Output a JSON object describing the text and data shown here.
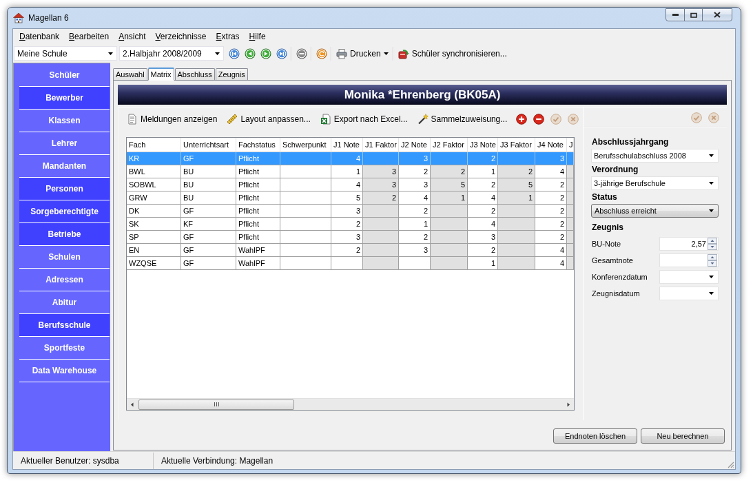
{
  "window": {
    "title": "Magellan 6"
  },
  "menu": [
    "Datenbank",
    "Bearbeiten",
    "Ansicht",
    "Verzeichnisse",
    "Extras",
    "Hilfe"
  ],
  "toolbar": {
    "school": "Meine Schule",
    "term": "2.Halbjahr 2008/2009",
    "print": "Drucken",
    "sync": "Schüler synchronisieren..."
  },
  "sidebar": {
    "items": [
      {
        "label": "Schüler",
        "color": "#6666ff"
      },
      {
        "label": "Bewerber",
        "color": "#4040ff"
      },
      {
        "label": "Klassen",
        "color": "#6666ff"
      },
      {
        "label": "Lehrer",
        "color": "#6666ff"
      },
      {
        "label": "Mandanten",
        "color": "#6666ff"
      },
      {
        "label": "Personen",
        "color": "#4040ff"
      },
      {
        "label": "Sorgeberechtigte",
        "color": "#4040ff"
      },
      {
        "label": "Betriebe",
        "color": "#4040ff"
      },
      {
        "label": "Schulen",
        "color": "#6666ff"
      },
      {
        "label": "Adressen",
        "color": "#6666ff"
      },
      {
        "label": "Abitur",
        "color": "#6666ff"
      },
      {
        "label": "Berufsschule",
        "color": "#4040ff"
      },
      {
        "label": "Sportfeste",
        "color": "#6666ff"
      },
      {
        "label": "Data Warehouse",
        "color": "#6666ff"
      }
    ]
  },
  "tabs": [
    {
      "label": "Auswahl",
      "selected": false
    },
    {
      "label": "Matrix",
      "selected": true
    },
    {
      "label": "Abschluss",
      "selected": false
    },
    {
      "label": "Zeugnis",
      "selected": false
    }
  ],
  "student": {
    "name": "Monika *Ehrenberg (BK05A)"
  },
  "matrix": {
    "toolbar": [
      {
        "label": "Meldungen anzeigen",
        "kind": "messages"
      },
      {
        "label": "Layout anpassen...",
        "kind": "layout"
      },
      {
        "label": "Export nach Excel...",
        "kind": "export"
      },
      {
        "label": "Sammelzuweisung...",
        "kind": "assign"
      }
    ],
    "row_actions": [
      {
        "kind": "add",
        "disabled": false
      },
      {
        "kind": "remove",
        "disabled": false
      },
      {
        "kind": "confirm",
        "disabled": true
      },
      {
        "kind": "cancel",
        "disabled": true
      }
    ],
    "table": {
      "columns": [
        {
          "label": "Fach",
          "kind": "text"
        },
        {
          "label": "Unterrichtsart",
          "kind": "text"
        },
        {
          "label": "Fachstatus",
          "kind": "text"
        },
        {
          "label": "Schwerpunkt",
          "kind": "text"
        },
        {
          "label": "J1 Note",
          "kind": "grade"
        },
        {
          "label": "J1 Faktor",
          "kind": "factor"
        },
        {
          "label": "J2 Note",
          "kind": "grade"
        },
        {
          "label": "J2 Faktor",
          "kind": "factor"
        },
        {
          "label": "J3 Note",
          "kind": "grade"
        },
        {
          "label": "J3 Faktor",
          "kind": "factor"
        },
        {
          "label": "J4 Note",
          "kind": "grade"
        },
        {
          "label": "J",
          "kind": "factor"
        }
      ],
      "rows": [
        {
          "selected": true,
          "fach": "KR",
          "unterrichtsart": "GF",
          "fachstatus": "Pflicht",
          "j1_note": "4",
          "j2_note": "3",
          "j3_note": "2",
          "j4_note": "3"
        },
        {
          "selected": false,
          "fach": "BWL",
          "unterrichtsart": "BU",
          "fachstatus": "Pflicht",
          "j1_note": "1",
          "j1_faktor": "3",
          "j2_note": "2",
          "j2_faktor": "2",
          "j3_note": "1",
          "j3_faktor": "2",
          "j4_note": "4"
        },
        {
          "selected": false,
          "fach": "SOBWL",
          "unterrichtsart": "BU",
          "fachstatus": "Pflicht",
          "j1_note": "4",
          "j1_faktor": "3",
          "j2_note": "3",
          "j2_faktor": "5",
          "j3_note": "2",
          "j3_faktor": "5",
          "j4_note": "2"
        },
        {
          "selected": false,
          "fach": "GRW",
          "unterrichtsart": "BU",
          "fachstatus": "Pflicht",
          "j1_note": "5",
          "j1_faktor": "2",
          "j2_note": "4",
          "j2_faktor": "1",
          "j3_note": "4",
          "j3_faktor": "1",
          "j4_note": "2"
        },
        {
          "selected": false,
          "fach": "DK",
          "unterrichtsart": "GF",
          "fachstatus": "Pflicht",
          "j1_note": "3",
          "j2_note": "2",
          "j3_note": "2",
          "j4_note": "2"
        },
        {
          "selected": false,
          "fach": "SK",
          "unterrichtsart": "KF",
          "fachstatus": "Pflicht",
          "j1_note": "2",
          "j2_note": "1",
          "j3_note": "4",
          "j4_note": "2"
        },
        {
          "selected": false,
          "fach": "SP",
          "unterrichtsart": "GF",
          "fachstatus": "Pflicht",
          "j1_note": "3",
          "j2_note": "2",
          "j3_note": "3",
          "j4_note": "2"
        },
        {
          "selected": false,
          "fach": "EN",
          "unterrichtsart": "GF",
          "fachstatus": "WahlPF",
          "j1_note": "2",
          "j2_note": "3",
          "j3_note": "2",
          "j4_note": "4"
        },
        {
          "selected": false,
          "fach": "WZQSE",
          "unterrichtsart": "GF",
          "fachstatus": "WahlPF",
          "j3_note": "1",
          "j4_note": "4"
        }
      ]
    }
  },
  "details": {
    "actions": [
      {
        "kind": "confirm",
        "disabled": true
      },
      {
        "kind": "cancel",
        "disabled": true
      }
    ],
    "fields": [
      {
        "kind": "heading",
        "label": "Abschlussjahrgang"
      },
      {
        "kind": "select",
        "value": "Berufsschulabschluss 2008"
      },
      {
        "kind": "heading",
        "label": "Verordnung"
      },
      {
        "kind": "select",
        "value": "3-jährige Berufschule"
      },
      {
        "kind": "heading",
        "label": "Status"
      },
      {
        "kind": "status_select",
        "value": "Abschluss erreicht"
      },
      {
        "kind": "heading",
        "label": "Zeugnis"
      },
      {
        "kind": "spinner",
        "label": "BU-Note",
        "value": "2,57"
      },
      {
        "kind": "spinner",
        "label": "Gesamtnote"
      },
      {
        "kind": "date",
        "label": "Konferenzdatum"
      },
      {
        "kind": "date",
        "label": "Zeugnisdatum"
      }
    ]
  },
  "buttons": [
    "Endnoten löschen",
    "Neu berechnen"
  ],
  "status_bar": [
    "Aktueller Benutzer: sysdba",
    "Aktuelle Verbindung: Magellan"
  ]
}
